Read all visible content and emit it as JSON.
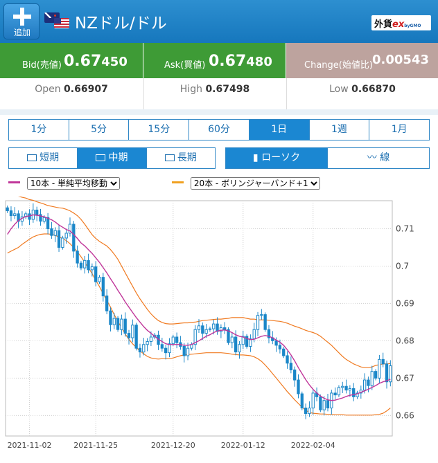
{
  "header": {
    "add_label": "追加",
    "title": "NZドル/ドル",
    "logo_text": "外貨",
    "logo_ex": "ex",
    "logo_gmo": "byGMO"
  },
  "quotes": {
    "bid": {
      "label": "Bid(売値)",
      "value_main": "0.67",
      "value_rest": "450"
    },
    "ask": {
      "label": "Ask(買値)",
      "value_main": "0.67",
      "value_rest": "480"
    },
    "change": {
      "label": "Change(始値比)",
      "value": "0.00543"
    }
  },
  "ohl": {
    "open_label": "Open",
    "open_value": "0.66907",
    "high_label": "High",
    "high_value": "0.67498",
    "low_label": "Low",
    "low_value": "0.66870"
  },
  "timeframes": [
    {
      "label": "1分",
      "active": false
    },
    {
      "label": "5分",
      "active": false
    },
    {
      "label": "15分",
      "active": false
    },
    {
      "label": "60分",
      "active": false
    },
    {
      "label": "1日",
      "active": true
    },
    {
      "label": "1週",
      "active": false
    },
    {
      "label": "1月",
      "active": false
    }
  ],
  "ranges": [
    {
      "label": "短期",
      "active": false,
      "icon": "arrows-in-icon"
    },
    {
      "label": "中期",
      "active": true,
      "icon": "range-box-icon"
    },
    {
      "label": "長期",
      "active": false,
      "icon": "arrows-out-icon"
    }
  ],
  "chart_types": [
    {
      "label": "ローソク",
      "active": true,
      "icon": "candlestick-icon"
    },
    {
      "label": "線",
      "active": false,
      "icon": "line-chart-icon"
    }
  ],
  "indicators": {
    "sma": {
      "value": "10本 - 単純平均移動",
      "color": "#c0369a"
    },
    "bb": {
      "value": "20本 - ボリンジャーバンド+1",
      "color": "#f0a020"
    }
  },
  "colors": {
    "header": "#1b7fc4",
    "bid_ask_bg": "#3e9b36",
    "change_bg": "#bda39e",
    "candle": "#1b87c8",
    "sma_line": "#c0369a",
    "bb_line": "#f07a20",
    "active_button": "#1b87d2"
  },
  "chart_data": {
    "type": "candlestick",
    "y_ticks": [
      "0.71",
      "0.7",
      "0.69",
      "0.68",
      "0.67",
      "0.66"
    ],
    "ylim": [
      0.6545,
      0.7175
    ],
    "x_tick_labels": [
      "2021-11-02",
      "2021-11-25",
      "2021-12-20",
      "2022-01-12",
      "2022-02-04"
    ],
    "x_tick_index": [
      6,
      24,
      45,
      64,
      83
    ],
    "close": [
      0.7148,
      0.7135,
      0.714,
      0.712,
      0.7132,
      0.714,
      0.7125,
      0.715,
      0.7138,
      0.712,
      0.713,
      0.71,
      0.7082,
      0.7095,
      0.705,
      0.7075,
      0.7088,
      0.7112,
      0.704,
      0.7008,
      0.6995,
      0.7015,
      0.699,
      0.6998,
      0.6958,
      0.697,
      0.692,
      0.688,
      0.6843,
      0.686,
      0.683,
      0.6858,
      0.682,
      0.6808,
      0.6842,
      0.678,
      0.677,
      0.679,
      0.6798,
      0.681,
      0.6815,
      0.679,
      0.678,
      0.6768,
      0.6792,
      0.681,
      0.6795,
      0.6785,
      0.676,
      0.678,
      0.679,
      0.683,
      0.684,
      0.682,
      0.683,
      0.6832,
      0.6845,
      0.6825,
      0.6835,
      0.683,
      0.6795,
      0.681,
      0.677,
      0.679,
      0.6812,
      0.6785,
      0.6805,
      0.683,
      0.6868,
      0.687,
      0.683,
      0.6808,
      0.68,
      0.6788,
      0.6778,
      0.676,
      0.674,
      0.6722,
      0.6695,
      0.6658,
      0.662,
      0.6605,
      0.662,
      0.666,
      0.665,
      0.6615,
      0.664,
      0.662,
      0.666,
      0.6655,
      0.6675,
      0.6678,
      0.6668,
      0.6672,
      0.665,
      0.666,
      0.6668,
      0.6695,
      0.668,
      0.6718,
      0.67,
      0.675,
      0.6738,
      0.669,
      0.6733
    ],
    "sma10": [
      0.7085,
      0.71,
      0.7112,
      0.7122,
      0.7128,
      0.7133,
      0.7134,
      0.7137,
      0.7136,
      0.7134,
      0.7132,
      0.7128,
      0.7124,
      0.7118,
      0.711,
      0.7104,
      0.7098,
      0.7094,
      0.7085,
      0.7074,
      0.7062,
      0.7054,
      0.7044,
      0.7034,
      0.7022,
      0.701,
      0.6996,
      0.6982,
      0.6966,
      0.6951,
      0.6935,
      0.692,
      0.6904,
      0.689,
      0.6876,
      0.6862,
      0.685,
      0.6838,
      0.6828,
      0.682,
      0.6812,
      0.6804,
      0.6798,
      0.6792,
      0.679,
      0.679,
      0.679,
      0.679,
      0.6788,
      0.6788,
      0.679,
      0.6795,
      0.68,
      0.6806,
      0.6812,
      0.6816,
      0.6822,
      0.6826,
      0.6828,
      0.6829,
      0.6826,
      0.6822,
      0.6816,
      0.6812,
      0.681,
      0.6806,
      0.6803,
      0.6804,
      0.6808,
      0.6812,
      0.6814,
      0.6812,
      0.6808,
      0.6802,
      0.6796,
      0.6788,
      0.6776,
      0.6762,
      0.6746,
      0.6728,
      0.6712,
      0.6696,
      0.6682,
      0.667,
      0.666,
      0.6652,
      0.6646,
      0.6642,
      0.664,
      0.6641,
      0.6644,
      0.6647,
      0.6651,
      0.6654,
      0.6656,
      0.6658,
      0.6662,
      0.6666,
      0.667,
      0.6675,
      0.668,
      0.6686,
      0.669,
      0.6693,
      0.6697
    ],
    "bb_upper": [
      0.7195,
      0.7192,
      0.719,
      0.7187,
      0.7184,
      0.7182,
      0.7178,
      0.7176,
      0.7172,
      0.7169,
      0.7166,
      0.7162,
      0.716,
      0.7158,
      0.7156,
      0.7155,
      0.7152,
      0.7148,
      0.7142,
      0.7135,
      0.7125,
      0.7112,
      0.7098,
      0.7084,
      0.7074,
      0.7066,
      0.706,
      0.7054,
      0.7044,
      0.7032,
      0.7018,
      0.7,
      0.6982,
      0.6964,
      0.6946,
      0.6928,
      0.6912,
      0.6898,
      0.6884,
      0.6872,
      0.6862,
      0.6854,
      0.6849,
      0.6846,
      0.6845,
      0.6845,
      0.6846,
      0.6847,
      0.6848,
      0.6848,
      0.6849,
      0.685,
      0.6852,
      0.6854,
      0.6855,
      0.6856,
      0.6857,
      0.6858,
      0.6858,
      0.6859,
      0.686,
      0.6862,
      0.6862,
      0.6862,
      0.6862,
      0.686,
      0.6858,
      0.6858,
      0.6856,
      0.6856,
      0.6856,
      0.6855,
      0.6854,
      0.6853,
      0.6852,
      0.685,
      0.6847,
      0.6843,
      0.6839,
      0.6836,
      0.6832,
      0.6828,
      0.6825,
      0.6822,
      0.6818,
      0.6812,
      0.6804,
      0.6796,
      0.6788,
      0.6778,
      0.6768,
      0.6758,
      0.675,
      0.6744,
      0.6738,
      0.6734,
      0.673,
      0.6728,
      0.6728,
      0.673,
      0.6734,
      0.6736,
      0.6738,
      0.6738,
      0.6739
    ],
    "bb_lower": [
      0.7035,
      0.704,
      0.7045,
      0.705,
      0.7058,
      0.7065,
      0.7072,
      0.7078,
      0.7082,
      0.7085,
      0.7086,
      0.7086,
      0.7085,
      0.7082,
      0.7078,
      0.7074,
      0.7068,
      0.706,
      0.705,
      0.7038,
      0.7025,
      0.701,
      0.6995,
      0.698,
      0.6962,
      0.6945,
      0.6926,
      0.6908,
      0.689,
      0.687,
      0.6852,
      0.6835,
      0.6818,
      0.6804,
      0.6792,
      0.6782,
      0.6773,
      0.6765,
      0.6758,
      0.6754,
      0.6752,
      0.6751,
      0.6752,
      0.6752,
      0.6752,
      0.6754,
      0.6757,
      0.676,
      0.6762,
      0.6763,
      0.6764,
      0.6765,
      0.6766,
      0.6767,
      0.6768,
      0.6768,
      0.6768,
      0.6768,
      0.6768,
      0.6767,
      0.6766,
      0.6764,
      0.6763,
      0.6762,
      0.6762,
      0.6761,
      0.676,
      0.6757,
      0.6752,
      0.6745,
      0.6735,
      0.6724,
      0.6712,
      0.67,
      0.6688,
      0.6676,
      0.6664,
      0.6653,
      0.6642,
      0.6632,
      0.6622,
      0.6614,
      0.6608,
      0.6606,
      0.6605,
      0.6604,
      0.6604,
      0.6603,
      0.6603,
      0.6602,
      0.6602,
      0.6602,
      0.6601,
      0.6601,
      0.6601,
      0.6601,
      0.6601,
      0.6601,
      0.6601,
      0.6601,
      0.6602,
      0.6603,
      0.6606,
      0.6612,
      0.662
    ]
  }
}
